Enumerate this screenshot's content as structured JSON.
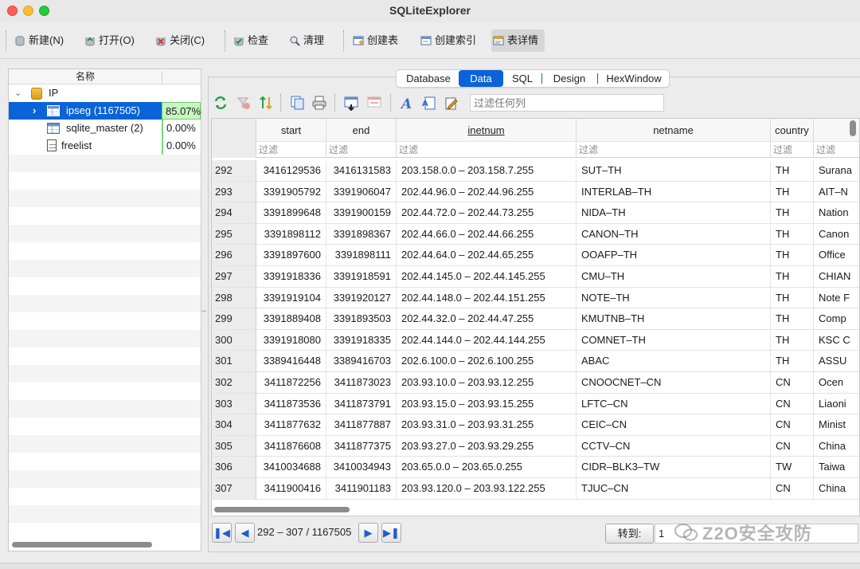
{
  "app": {
    "title": "SQLiteExplorer"
  },
  "toolbar": {
    "new": "新建(N)",
    "open": "打开(O)",
    "close": "关闭(C)",
    "check": "检查",
    "clean": "清理",
    "create_table": "创建表",
    "create_index": "创建索引",
    "table_details": "表详情"
  },
  "tree": {
    "header_name": "名称",
    "db": {
      "label": "IP"
    },
    "items": [
      {
        "label": "ipseg (1167505)",
        "pct": "85.07%"
      },
      {
        "label": "sqlite_master (2)",
        "pct": "0.00%"
      },
      {
        "label": "freelist",
        "pct": "0.00%"
      }
    ]
  },
  "tabs": [
    "Database",
    "Data",
    "SQL",
    "Design",
    "HexWindow"
  ],
  "active_tab": "Data",
  "filter_all_placeholder": "过滤任何列",
  "grid": {
    "columns": [
      "start",
      "end",
      "inetnum",
      "netname",
      "country",
      ""
    ],
    "filter_placeholder": "过滤",
    "rows": [
      {
        "n": "292",
        "start": "3416129536",
        "end": "3416131583",
        "inetnum": "203.158.0.0 – 203.158.7.255",
        "netname": "SUT–TH",
        "country": "TH",
        "descr": "Surana"
      },
      {
        "n": "293",
        "start": "3391905792",
        "end": "3391906047",
        "inetnum": "202.44.96.0 – 202.44.96.255",
        "netname": "INTERLAB–TH",
        "country": "TH",
        "descr": "AIT–N"
      },
      {
        "n": "294",
        "start": "3391899648",
        "end": "3391900159",
        "inetnum": "202.44.72.0 – 202.44.73.255",
        "netname": "NIDA–TH",
        "country": "TH",
        "descr": "Nation"
      },
      {
        "n": "295",
        "start": "3391898112",
        "end": "3391898367",
        "inetnum": "202.44.66.0 – 202.44.66.255",
        "netname": "CANON–TH",
        "country": "TH",
        "descr": "Canon"
      },
      {
        "n": "296",
        "start": "3391897600",
        "end": "3391898111",
        "inetnum": "202.44.64.0 – 202.44.65.255",
        "netname": "OOAFP–TH",
        "country": "TH",
        "descr": "Office"
      },
      {
        "n": "297",
        "start": "3391918336",
        "end": "3391918591",
        "inetnum": "202.44.145.0 – 202.44.145.255",
        "netname": "CMU–TH",
        "country": "TH",
        "descr": "CHIAN"
      },
      {
        "n": "298",
        "start": "3391919104",
        "end": "3391920127",
        "inetnum": "202.44.148.0 – 202.44.151.255",
        "netname": "NOTE–TH",
        "country": "TH",
        "descr": "Note F"
      },
      {
        "n": "299",
        "start": "3391889408",
        "end": "3391893503",
        "inetnum": "202.44.32.0 – 202.44.47.255",
        "netname": "KMUTNB–TH",
        "country": "TH",
        "descr": "Comp"
      },
      {
        "n": "300",
        "start": "3391918080",
        "end": "3391918335",
        "inetnum": "202.44.144.0 – 202.44.144.255",
        "netname": "COMNET–TH",
        "country": "TH",
        "descr": "KSC C"
      },
      {
        "n": "301",
        "start": "3389416448",
        "end": "3389416703",
        "inetnum": "202.6.100.0 – 202.6.100.255",
        "netname": "ABAC",
        "country": "TH",
        "descr": "ASSU"
      },
      {
        "n": "302",
        "start": "3411872256",
        "end": "3411873023",
        "inetnum": "203.93.10.0 – 203.93.12.255",
        "netname": "CNOOCNET–CN",
        "country": "CN",
        "descr": "Ocen"
      },
      {
        "n": "303",
        "start": "3411873536",
        "end": "3411873791",
        "inetnum": "203.93.15.0 – 203.93.15.255",
        "netname": "LFTC–CN",
        "country": "CN",
        "descr": "Liaoni"
      },
      {
        "n": "304",
        "start": "3411877632",
        "end": "3411877887",
        "inetnum": "203.93.31.0 – 203.93.31.255",
        "netname": "CEIC–CN",
        "country": "CN",
        "descr": "Minist"
      },
      {
        "n": "305",
        "start": "3411876608",
        "end": "3411877375",
        "inetnum": "203.93.27.0 – 203.93.29.255",
        "netname": "CCTV–CN",
        "country": "CN",
        "descr": "China"
      },
      {
        "n": "306",
        "start": "3410034688",
        "end": "3410034943",
        "inetnum": "203.65.0.0 – 203.65.0.255",
        "netname": "CIDR–BLK3–TW",
        "country": "TW",
        "descr": "Taiwa"
      },
      {
        "n": "307",
        "start": "3411900416",
        "end": "3411901183",
        "inetnum": "203.93.120.0 – 203.93.122.255",
        "netname": "TJUC–CN",
        "country": "CN",
        "descr": "China"
      }
    ]
  },
  "nav": {
    "page_info": "292 – 307 / 1167505",
    "goto_label": "转到:",
    "goto_value": "1"
  },
  "watermark": "Z2O安全攻防",
  "colors": {
    "accent": "#0a63d8",
    "progress": "#c9f5c2"
  }
}
